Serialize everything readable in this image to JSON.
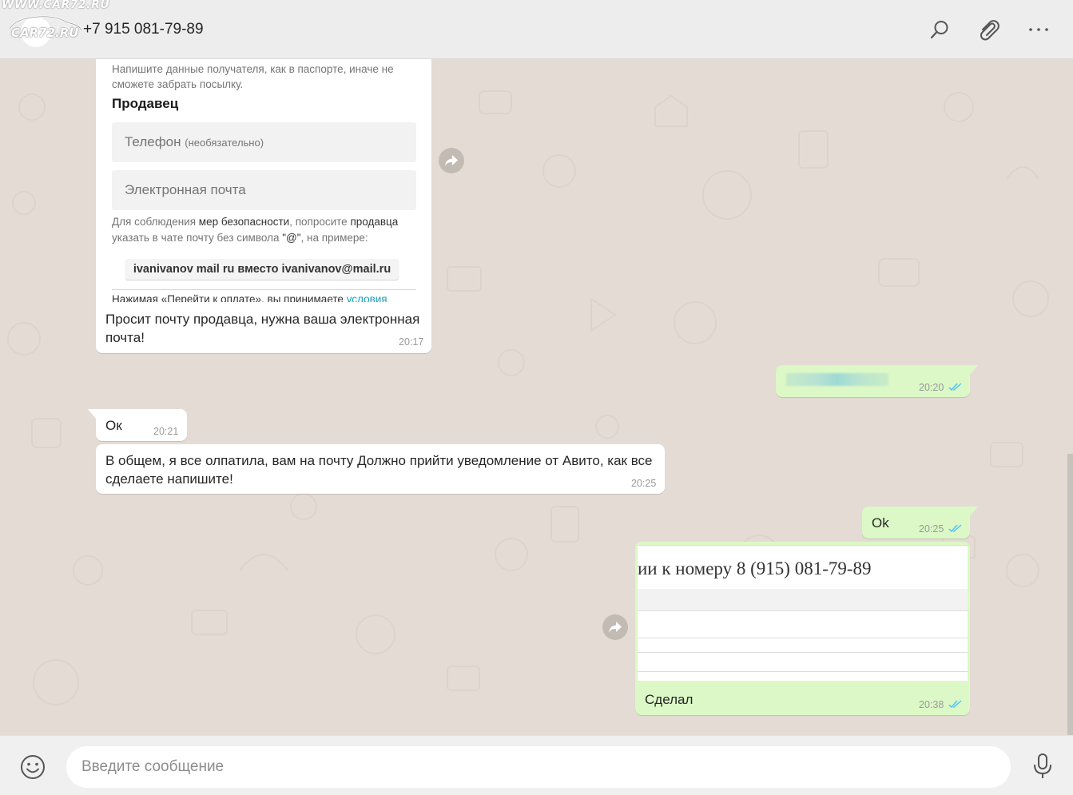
{
  "header": {
    "watermark_top": "WWW.CAR72.RU",
    "watermark_sub": "CAR72.RU",
    "contact_name": "+7 915 081-79-89",
    "icons": [
      "search-icon",
      "paperclip-icon",
      "more-icon"
    ]
  },
  "messages": [
    {
      "direction": "in",
      "screenshot": {
        "hint": "Напишите данные получателя, как в паспорте, иначе не сможете забрать посылку.",
        "seller_heading": "Продавец",
        "phone_label": "Телефон",
        "phone_label_suffix": "(необязательно)",
        "email_label": "Электронная почта",
        "note_prefix": "Для соблюдения",
        "note_b1": "мер безопасности",
        "note_mid": ", попросите",
        "note_b2": "продавца",
        "note_rest": "указать в чате почту без символа",
        "note_symbol": "\"@\"",
        "note_end": ", на примере:",
        "example": "ivanivanov mail ru вместо ivanivanov@mail.ru",
        "cut_text": "Нажимая «Перейти к оплате», вы принимаете",
        "cut_link": "условия"
      },
      "text": "Просит почту продавца, нужна ваша электронная почта!",
      "time": "20:17"
    },
    {
      "direction": "out",
      "text_blurred": true,
      "time": "20:20",
      "status": "read"
    },
    {
      "direction": "in",
      "text": "Ок",
      "time": "20:21"
    },
    {
      "direction": "in",
      "text": "В общем, я все олпатила, вам на почту Должно прийти уведомление от Авито, как все сделаете напишите!",
      "time": "20:25"
    },
    {
      "direction": "out",
      "text": "Ok",
      "time": "20:25",
      "status": "read"
    },
    {
      "direction": "out",
      "screenshot": {
        "phone_line": "ии к номеру 8 (915) 081-79-89"
      },
      "text": "Сделал",
      "time": "20:38",
      "status": "read"
    }
  ],
  "composer": {
    "placeholder": "Введите сообщение",
    "icons": [
      "emoji-icon",
      "microphone-icon"
    ]
  },
  "colors": {
    "header_bg": "#ededed",
    "chat_bg": "#e4dcd4",
    "incoming_bubble": "#ffffff",
    "outgoing_bubble": "#dcf8c6",
    "read_ticks": "#4fc3f7"
  }
}
